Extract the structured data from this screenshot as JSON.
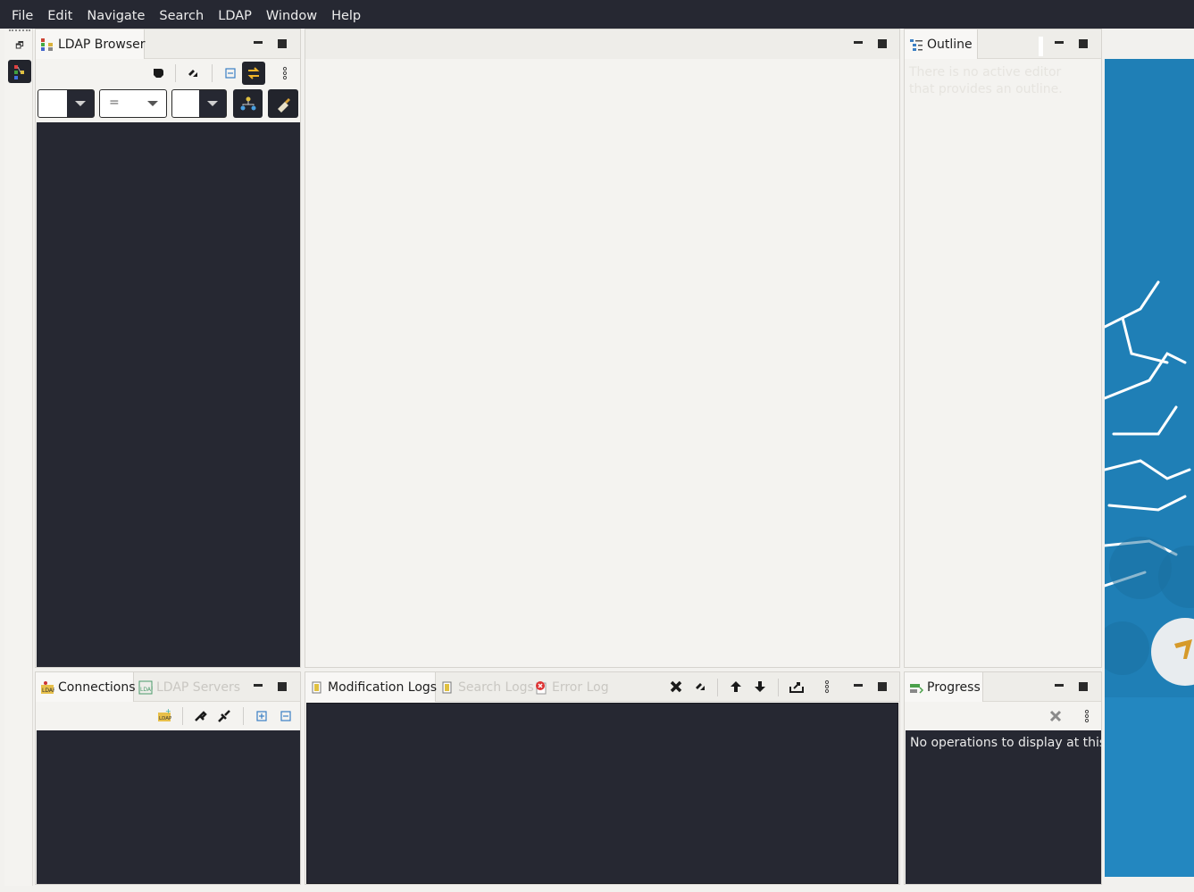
{
  "menubar": {
    "items": [
      "File",
      "Edit",
      "Navigate",
      "Search",
      "LDAP",
      "Window",
      "Help"
    ]
  },
  "trim": {
    "restore_icon": "restore-icon",
    "perspective_icon": "ldap-perspective-icon"
  },
  "ldap_browser": {
    "tab_label": "LDAP Browser",
    "quick_search": {
      "attribute_value": "",
      "operator_value": "=",
      "value": ""
    }
  },
  "outline": {
    "tab_label": "Outline",
    "message": "There is no active editor that provides an outline."
  },
  "connections": {
    "tab_label": "Connections",
    "second_tab_label": "LDAP Servers"
  },
  "logs": {
    "tabs": [
      "Modification Logs",
      "Search Logs",
      "Error Log"
    ]
  },
  "progress": {
    "tab_label": "Progress",
    "message": "No operations to display at this time."
  },
  "colors": {
    "dark_bg": "#262832",
    "panel_bg": "#f4f3f0",
    "wallpaper": "#1f7fb6"
  }
}
